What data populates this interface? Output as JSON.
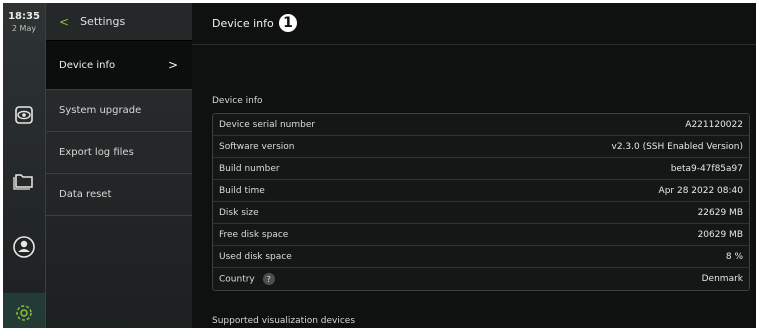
{
  "status": {
    "time": "18:35",
    "date": "2 May"
  },
  "menu": {
    "back_label": "Settings",
    "items": [
      {
        "label": "Device info"
      },
      {
        "label": "System upgrade"
      },
      {
        "label": "Export log files"
      },
      {
        "label": "Data reset"
      }
    ]
  },
  "main": {
    "title": "Device info",
    "annotation_number": "1",
    "section_title": "Device info",
    "rows": [
      {
        "label": "Device serial number",
        "value": "A221120022"
      },
      {
        "label": "Software version",
        "value": "v2.3.0 (SSH Enabled Version)"
      },
      {
        "label": "Build number",
        "value": "beta9-47f85a97"
      },
      {
        "label": "Build time",
        "value": "Apr 28 2022 08:40"
      },
      {
        "label": "Disk size",
        "value": "22629 MB"
      },
      {
        "label": "Free disk space",
        "value": "20629 MB"
      },
      {
        "label": "Used disk space",
        "value": "8 %"
      },
      {
        "label": "Country",
        "value": "Denmark",
        "help": "?"
      }
    ],
    "section_title2": "Supported visualization devices"
  },
  "colors": {
    "accent": "#8fbf3a",
    "background": "#0f1010"
  },
  "icons": [
    "eye-icon",
    "folder-icon",
    "user-icon",
    "gear-icon",
    "chevron-right-icon",
    "back-chevron-icon",
    "help-icon"
  ]
}
